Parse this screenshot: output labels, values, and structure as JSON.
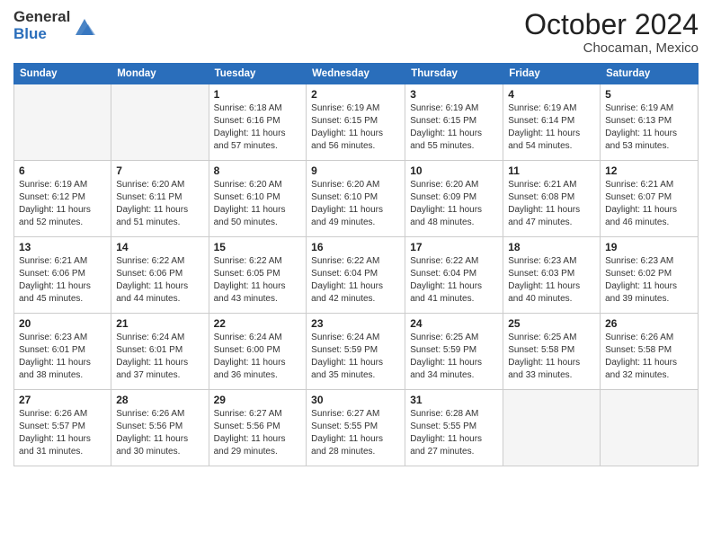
{
  "header": {
    "logo_general": "General",
    "logo_blue": "Blue",
    "month": "October 2024",
    "location": "Chocaman, Mexico"
  },
  "days_of_week": [
    "Sunday",
    "Monday",
    "Tuesday",
    "Wednesday",
    "Thursday",
    "Friday",
    "Saturday"
  ],
  "weeks": [
    [
      {
        "day": "",
        "empty": true
      },
      {
        "day": "",
        "empty": true
      },
      {
        "day": "1",
        "sunrise": "Sunrise: 6:18 AM",
        "sunset": "Sunset: 6:16 PM",
        "daylight": "Daylight: 11 hours and 57 minutes."
      },
      {
        "day": "2",
        "sunrise": "Sunrise: 6:19 AM",
        "sunset": "Sunset: 6:15 PM",
        "daylight": "Daylight: 11 hours and 56 minutes."
      },
      {
        "day": "3",
        "sunrise": "Sunrise: 6:19 AM",
        "sunset": "Sunset: 6:15 PM",
        "daylight": "Daylight: 11 hours and 55 minutes."
      },
      {
        "day": "4",
        "sunrise": "Sunrise: 6:19 AM",
        "sunset": "Sunset: 6:14 PM",
        "daylight": "Daylight: 11 hours and 54 minutes."
      },
      {
        "day": "5",
        "sunrise": "Sunrise: 6:19 AM",
        "sunset": "Sunset: 6:13 PM",
        "daylight": "Daylight: 11 hours and 53 minutes."
      }
    ],
    [
      {
        "day": "6",
        "sunrise": "Sunrise: 6:19 AM",
        "sunset": "Sunset: 6:12 PM",
        "daylight": "Daylight: 11 hours and 52 minutes."
      },
      {
        "day": "7",
        "sunrise": "Sunrise: 6:20 AM",
        "sunset": "Sunset: 6:11 PM",
        "daylight": "Daylight: 11 hours and 51 minutes."
      },
      {
        "day": "8",
        "sunrise": "Sunrise: 6:20 AM",
        "sunset": "Sunset: 6:10 PM",
        "daylight": "Daylight: 11 hours and 50 minutes."
      },
      {
        "day": "9",
        "sunrise": "Sunrise: 6:20 AM",
        "sunset": "Sunset: 6:10 PM",
        "daylight": "Daylight: 11 hours and 49 minutes."
      },
      {
        "day": "10",
        "sunrise": "Sunrise: 6:20 AM",
        "sunset": "Sunset: 6:09 PM",
        "daylight": "Daylight: 11 hours and 48 minutes."
      },
      {
        "day": "11",
        "sunrise": "Sunrise: 6:21 AM",
        "sunset": "Sunset: 6:08 PM",
        "daylight": "Daylight: 11 hours and 47 minutes."
      },
      {
        "day": "12",
        "sunrise": "Sunrise: 6:21 AM",
        "sunset": "Sunset: 6:07 PM",
        "daylight": "Daylight: 11 hours and 46 minutes."
      }
    ],
    [
      {
        "day": "13",
        "sunrise": "Sunrise: 6:21 AM",
        "sunset": "Sunset: 6:06 PM",
        "daylight": "Daylight: 11 hours and 45 minutes."
      },
      {
        "day": "14",
        "sunrise": "Sunrise: 6:22 AM",
        "sunset": "Sunset: 6:06 PM",
        "daylight": "Daylight: 11 hours and 44 minutes."
      },
      {
        "day": "15",
        "sunrise": "Sunrise: 6:22 AM",
        "sunset": "Sunset: 6:05 PM",
        "daylight": "Daylight: 11 hours and 43 minutes."
      },
      {
        "day": "16",
        "sunrise": "Sunrise: 6:22 AM",
        "sunset": "Sunset: 6:04 PM",
        "daylight": "Daylight: 11 hours and 42 minutes."
      },
      {
        "day": "17",
        "sunrise": "Sunrise: 6:22 AM",
        "sunset": "Sunset: 6:04 PM",
        "daylight": "Daylight: 11 hours and 41 minutes."
      },
      {
        "day": "18",
        "sunrise": "Sunrise: 6:23 AM",
        "sunset": "Sunset: 6:03 PM",
        "daylight": "Daylight: 11 hours and 40 minutes."
      },
      {
        "day": "19",
        "sunrise": "Sunrise: 6:23 AM",
        "sunset": "Sunset: 6:02 PM",
        "daylight": "Daylight: 11 hours and 39 minutes."
      }
    ],
    [
      {
        "day": "20",
        "sunrise": "Sunrise: 6:23 AM",
        "sunset": "Sunset: 6:01 PM",
        "daylight": "Daylight: 11 hours and 38 minutes."
      },
      {
        "day": "21",
        "sunrise": "Sunrise: 6:24 AM",
        "sunset": "Sunset: 6:01 PM",
        "daylight": "Daylight: 11 hours and 37 minutes."
      },
      {
        "day": "22",
        "sunrise": "Sunrise: 6:24 AM",
        "sunset": "Sunset: 6:00 PM",
        "daylight": "Daylight: 11 hours and 36 minutes."
      },
      {
        "day": "23",
        "sunrise": "Sunrise: 6:24 AM",
        "sunset": "Sunset: 5:59 PM",
        "daylight": "Daylight: 11 hours and 35 minutes."
      },
      {
        "day": "24",
        "sunrise": "Sunrise: 6:25 AM",
        "sunset": "Sunset: 5:59 PM",
        "daylight": "Daylight: 11 hours and 34 minutes."
      },
      {
        "day": "25",
        "sunrise": "Sunrise: 6:25 AM",
        "sunset": "Sunset: 5:58 PM",
        "daylight": "Daylight: 11 hours and 33 minutes."
      },
      {
        "day": "26",
        "sunrise": "Sunrise: 6:26 AM",
        "sunset": "Sunset: 5:58 PM",
        "daylight": "Daylight: 11 hours and 32 minutes."
      }
    ],
    [
      {
        "day": "27",
        "sunrise": "Sunrise: 6:26 AM",
        "sunset": "Sunset: 5:57 PM",
        "daylight": "Daylight: 11 hours and 31 minutes."
      },
      {
        "day": "28",
        "sunrise": "Sunrise: 6:26 AM",
        "sunset": "Sunset: 5:56 PM",
        "daylight": "Daylight: 11 hours and 30 minutes."
      },
      {
        "day": "29",
        "sunrise": "Sunrise: 6:27 AM",
        "sunset": "Sunset: 5:56 PM",
        "daylight": "Daylight: 11 hours and 29 minutes."
      },
      {
        "day": "30",
        "sunrise": "Sunrise: 6:27 AM",
        "sunset": "Sunset: 5:55 PM",
        "daylight": "Daylight: 11 hours and 28 minutes."
      },
      {
        "day": "31",
        "sunrise": "Sunrise: 6:28 AM",
        "sunset": "Sunset: 5:55 PM",
        "daylight": "Daylight: 11 hours and 27 minutes."
      },
      {
        "day": "",
        "empty": true
      },
      {
        "day": "",
        "empty": true
      }
    ]
  ]
}
